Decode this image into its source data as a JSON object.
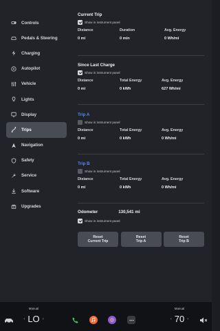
{
  "sidebar": {
    "items": [
      {
        "label": "Controls",
        "icon": "toggle-icon"
      },
      {
        "label": "Pedals & Steering",
        "icon": "car-icon"
      },
      {
        "label": "Charging",
        "icon": "bolt-icon"
      },
      {
        "label": "Autopilot",
        "icon": "steering-wheel-icon"
      },
      {
        "label": "Vehicle",
        "icon": "sliders-icon"
      },
      {
        "label": "Lights",
        "icon": "light-icon"
      },
      {
        "label": "Display",
        "icon": "display-icon"
      },
      {
        "label": "Trips",
        "icon": "trips-icon",
        "active": true
      },
      {
        "label": "Navigation",
        "icon": "navigation-icon"
      },
      {
        "label": "Safety",
        "icon": "shield-icon"
      },
      {
        "label": "Service",
        "icon": "wrench-icon"
      },
      {
        "label": "Software",
        "icon": "download-icon"
      },
      {
        "label": "Upgrades",
        "icon": "upgrades-icon"
      }
    ]
  },
  "checkbox_label": "Show in instrument panel",
  "current_trip": {
    "title": "Current Trip",
    "checked": true,
    "stats": [
      {
        "label": "Distance",
        "value": "0 mi"
      },
      {
        "label": "Duration",
        "value": "0 min"
      },
      {
        "label": "Avg. Energy",
        "value": "0 Wh/mi"
      }
    ]
  },
  "since_last_charge": {
    "title": "Since Last Charge",
    "checked": true,
    "stats": [
      {
        "label": "Distance",
        "value": "0 mi"
      },
      {
        "label": "Total Energy",
        "value": "0 kWh"
      },
      {
        "label": "Avg. Energy",
        "value": "627 Wh/mi"
      }
    ]
  },
  "trip_a": {
    "title": "Trip A",
    "checked": false,
    "stats": [
      {
        "label": "Distance",
        "value": "0 mi"
      },
      {
        "label": "Total Energy",
        "value": "0 kWh"
      },
      {
        "label": "Avg. Energy",
        "value": "0 Wh/mi"
      }
    ]
  },
  "trip_b": {
    "title": "Trip B",
    "checked": false,
    "stats": [
      {
        "label": "Distance",
        "value": "0 mi"
      },
      {
        "label": "Total Energy",
        "value": "0 kWh"
      },
      {
        "label": "Avg. Energy",
        "value": "0 Wh/mi"
      }
    ]
  },
  "odometer": {
    "label": "Odometer",
    "value": "130,541 mi",
    "checked": true
  },
  "reset_buttons": {
    "current": [
      "Reset",
      "Current Trip"
    ],
    "a": [
      "Reset",
      "Trip A"
    ],
    "b": [
      "Reset",
      "Trip B"
    ]
  },
  "bottom_bar": {
    "left_mode": "Manual",
    "left_temp": "LO",
    "right_mode": "Manual",
    "right_temp": "70",
    "apps": [
      "phone-icon",
      "music-icon",
      "camera-icon",
      "more-icon"
    ]
  },
  "colors": {
    "accent_blue": "#4f8df5",
    "phone_green": "#3cc35d",
    "music_orange": "#f06a3a",
    "camera_purple": "#8b5bd6"
  }
}
